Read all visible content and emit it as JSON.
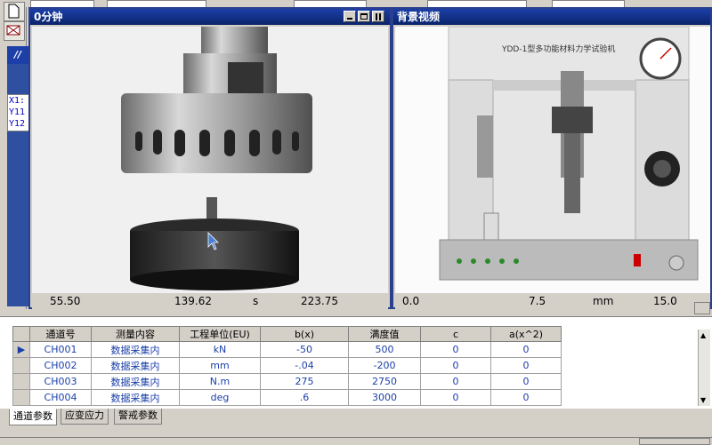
{
  "windows": {
    "left": {
      "title": "0分钟"
    },
    "right": {
      "title": "背景视频"
    }
  },
  "coords": [
    "X1:",
    "Y11",
    "Y12"
  ],
  "readout_left": {
    "v1": "55.50",
    "v2": "139.62",
    "unit": "s",
    "v3": "223.75"
  },
  "readout_right": {
    "v1": "0.0",
    "v2": "7.5",
    "unit": "mm",
    "v3": "15.0"
  },
  "machine_label": "YDD-1型多功能材料力学试验机",
  "grid": {
    "headers": [
      "通道号",
      "测量内容",
      "工程单位(EU)",
      "b(x)",
      "满度值",
      "c",
      "a(x^2)"
    ],
    "rows": [
      [
        "CH001",
        "数据采集内",
        "kN",
        "-50",
        "500",
        "0",
        "0"
      ],
      [
        "CH002",
        "数据采集内",
        "mm",
        "-.04",
        "-200",
        "0",
        "0"
      ],
      [
        "CH003",
        "数据采集内",
        "N.m",
        "275",
        "2750",
        "0",
        "0"
      ],
      [
        "CH004",
        "数据采集内",
        "deg",
        ".6",
        "3000",
        "0",
        "0"
      ]
    ]
  },
  "tabs": [
    "通道参数",
    "应变应力",
    "警戒参数"
  ]
}
